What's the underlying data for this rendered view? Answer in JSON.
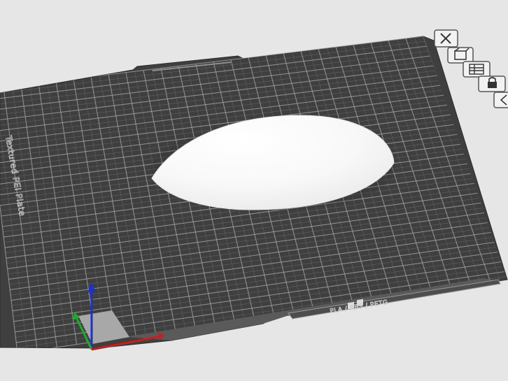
{
  "plate": {
    "name": "Textured PEI Plate",
    "material_label": "PLA / ABS / PETG"
  },
  "colors": {
    "background": "#e6e6e6",
    "plate": "#3f3f3f",
    "plate_dark": "#343434",
    "grid": "#a9a9a9",
    "axis_x": "#c81e1e",
    "axis_y": "#1eaa2d",
    "axis_z": "#1e32c8",
    "model": "#f7f7f7"
  },
  "toolbar": {
    "buttons": [
      {
        "icon": "close-icon"
      },
      {
        "icon": "orient-icon"
      },
      {
        "icon": "arrange-icon"
      },
      {
        "icon": "lock-icon"
      },
      {
        "icon": "settings-icon"
      }
    ]
  },
  "model": {
    "name": "dome"
  }
}
